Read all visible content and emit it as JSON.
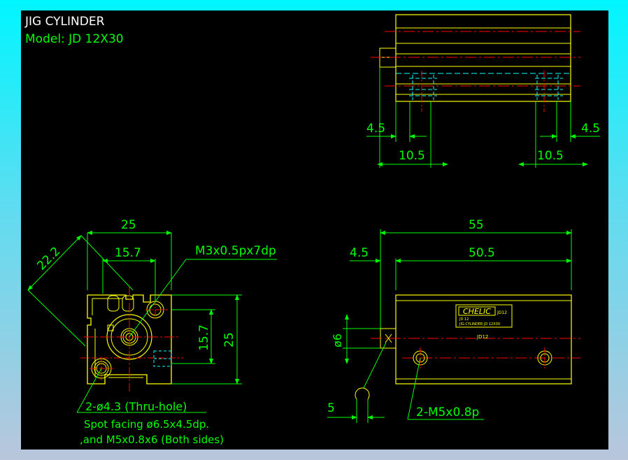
{
  "title": {
    "line1": "JIG CYLINDER",
    "line2": "Model:  JD 12X30"
  },
  "colors": {
    "background": "#000000",
    "frame_top": "#00f6ff",
    "frame_bottom": "#b9c6dc",
    "outline": "#ffff00",
    "dimension": "#00ff00",
    "centerline": "#ff0000",
    "hidden": "#00ffff",
    "text": "#ffffff"
  },
  "top_view": {
    "dim_left_outer": "4.5",
    "dim_right_outer": "4.5",
    "dim_left_inner": "10.5",
    "dim_right_inner": "10.5"
  },
  "end_view": {
    "dim_width": "25",
    "dim_inner_width": "15.7",
    "dim_diagonal": "22.2",
    "dim_height": "25",
    "dim_inner_height": "15.7",
    "callout_thread": "M3x0.5px7dp",
    "note_line1": "2-ø4.3  (Thru-hole)",
    "note_line2": "Spot  facing  ø6.5x4.5dp.",
    "note_line3": ",and  M5x0.8x6  (Both  sides)"
  },
  "side_view": {
    "dim_overall": "55",
    "dim_body": "50.5",
    "dim_offset": "4.5",
    "dim_rod_dia": "ø6",
    "dim_wrench": "5",
    "callout_port": "2-M5x0.8p",
    "label_brand": "CHELIC",
    "label_mark": "JD12",
    "label_small1": "JD 12",
    "label_small2": "JIG CYLINDER  JD 12X30",
    "body_mark": "JD12"
  }
}
